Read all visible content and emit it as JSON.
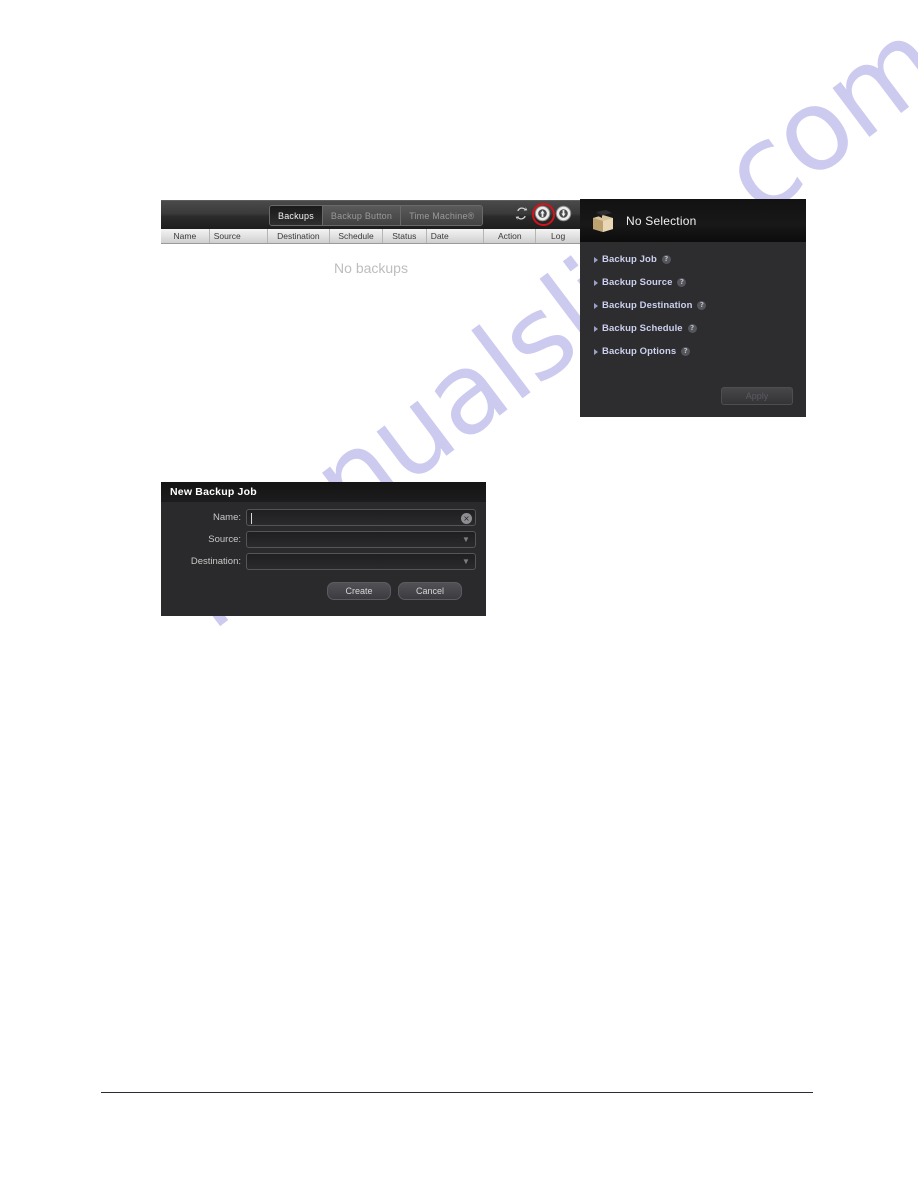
{
  "toolbar": {
    "tabs": [
      {
        "label": "Backups",
        "active": true
      },
      {
        "label": "Backup Button",
        "active": false
      },
      {
        "label": "Time Machine®",
        "active": false
      }
    ],
    "icons": [
      {
        "name": "refresh-icon",
        "highlighted": false
      },
      {
        "name": "new-backup-job-icon",
        "highlighted": true
      },
      {
        "name": "restore-icon",
        "highlighted": false
      }
    ],
    "highlight_color": "#d4121b"
  },
  "table": {
    "columns": [
      {
        "label": "Name",
        "width": 49,
        "align": "right"
      },
      {
        "label": "Source",
        "width": 58,
        "align": "left"
      },
      {
        "label": "Destination",
        "width": 63,
        "align": "center"
      },
      {
        "label": "Schedule",
        "width": 53,
        "align": "center"
      },
      {
        "label": "Status",
        "width": 44,
        "align": "center"
      },
      {
        "label": "Date",
        "width": 58,
        "align": "left"
      },
      {
        "label": "Action",
        "width": 52,
        "align": "center"
      },
      {
        "label": "Log",
        "width": 45,
        "align": "center"
      }
    ],
    "empty_message": "No backups"
  },
  "info_panel": {
    "icon": "package-box-icon",
    "title": "No Selection",
    "sections": [
      {
        "label": "Backup Job",
        "help": "?"
      },
      {
        "label": "Backup Source",
        "help": "?"
      },
      {
        "label": "Backup Destination",
        "help": "?"
      },
      {
        "label": "Backup Schedule",
        "help": "?"
      },
      {
        "label": "Backup Options",
        "help": "?"
      }
    ],
    "apply_label": "Apply"
  },
  "dialog": {
    "title": "New Backup Job",
    "fields": [
      {
        "label": "Name:",
        "value": "",
        "type": "text",
        "clear_icon": "×"
      },
      {
        "label": "Source:",
        "value": "",
        "type": "select"
      },
      {
        "label": "Destination:",
        "value": "",
        "type": "select"
      }
    ],
    "create_label": "Create",
    "cancel_label": "Cancel"
  },
  "watermark": {
    "text": "manualslive.com",
    "color": "#b9b6e8"
  }
}
